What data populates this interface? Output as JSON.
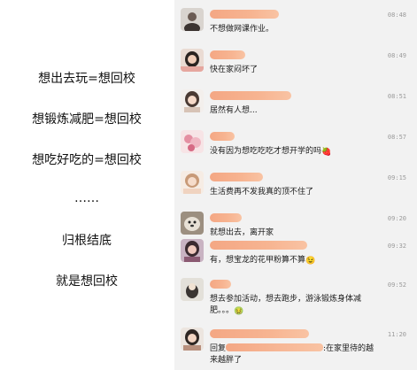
{
  "left_panel": {
    "lines": [
      "想出去玩=想回校",
      "想锻炼减肥=想回校",
      "想吃好吃的=想回校",
      "……",
      "归根结底",
      "就是想回校"
    ]
  },
  "chat": {
    "messages": [
      {
        "time": "08:48",
        "text": "不想做网课作业。",
        "emoji": ""
      },
      {
        "time": "08:49",
        "text": "快在家闷坏了",
        "emoji": ""
      },
      {
        "time": "08:51",
        "text": "居然有人想...",
        "emoji": ""
      },
      {
        "time": "08:57",
        "text": "没有因为想吃吃吃才想开学的吗",
        "emoji": "🍓"
      },
      {
        "time": "09:15",
        "text": "生活费再不发我真的顶不住了",
        "emoji": ""
      },
      {
        "time": "09:20",
        "text": "就想出去，离开家",
        "emoji": ""
      },
      {
        "time": "09:32",
        "text": "有，想宝龙的花甲粉算不算",
        "emoji": "😉"
      },
      {
        "time": "09:52",
        "text_line1": "想去参加活动，想去跑步，游泳锻炼身体减",
        "text_line2": "肥。。。",
        "emoji": "🤢"
      },
      {
        "time": "11:20",
        "reply_prefix": "回复",
        "reply_suffix": ":在家里待的越",
        "text_line2": "来越胖了"
      }
    ]
  }
}
